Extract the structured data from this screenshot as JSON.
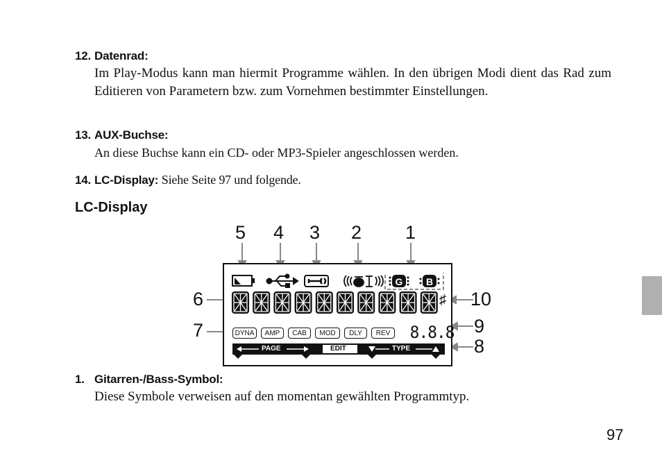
{
  "items": [
    {
      "number": "12.",
      "title": "Datenrad:",
      "body": "Im Play-Modus kann man hiermit Programme wählen. In den übrigen Modi dient das Rad zum Editieren von Parametern bzw. zum Vornehmen bestimmter Einstellungen."
    },
    {
      "number": "13.",
      "title": "AUX-Buchse:",
      "body": "An diese Buchse kann ein CD- oder MP3-Spieler angeschlossen werden."
    },
    {
      "number": "14.",
      "title": "LC-Display:",
      "body": "Siehe Seite 97 und folgende."
    }
  ],
  "section": {
    "title": "LC-Display"
  },
  "diagram": {
    "callouts": {
      "c1": "1",
      "c2": "2",
      "c3": "3",
      "c4": "4",
      "c5": "5",
      "c6": "6",
      "c7": "7",
      "c8": "8",
      "c9": "9",
      "c10": "10"
    },
    "icons": [
      "battery-icon",
      "usb-icon",
      "wrench-icon",
      "drum-icon",
      "guitar-g-icon",
      "bass-b-icon"
    ],
    "guitar_letter": "G",
    "bass_letter": "B",
    "segment_digit_count": 10,
    "sharp_symbol": "♯",
    "mode_labels": [
      "DYNA",
      "AMP",
      "CAB",
      "MOD",
      "DLY",
      "REV"
    ],
    "numeric_display": "8.8.8",
    "page_bar": {
      "page_label": "PAGE",
      "edit_label": "EDIT",
      "type_label": "TYPE"
    }
  },
  "item_1": {
    "number": "1.",
    "title": "Gitarren-/Bass-Symbol:",
    "body": "Diese Symbole verweisen auf den momentan gewählten Programmtyp."
  },
  "page_number": "97",
  "colors": {
    "tab_gray": "#b0b0b0",
    "arrow_gray": "#888888",
    "lcd_black": "#111111"
  }
}
